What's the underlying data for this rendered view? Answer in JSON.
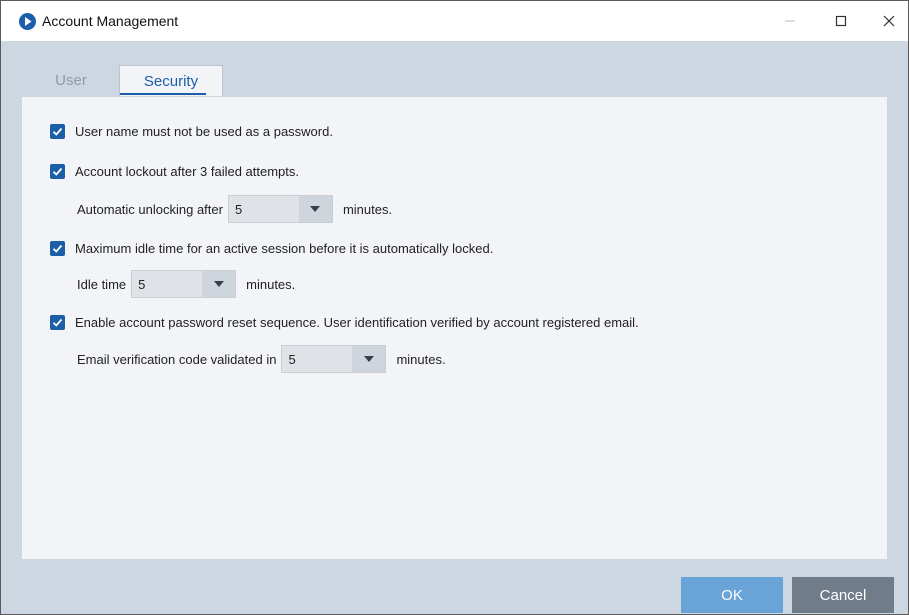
{
  "window": {
    "title": "Account Management",
    "controls": {
      "minimize": "minimize-icon",
      "maximize": "maximize-icon",
      "close": "close-icon"
    }
  },
  "tabs": [
    {
      "label": "User",
      "active": false
    },
    {
      "label": "Security",
      "active": true
    }
  ],
  "security": {
    "options": [
      {
        "label": "User name must not be used as a password.",
        "checked": true
      },
      {
        "label": "Account lockout after 3 failed attempts.",
        "checked": true,
        "sub": {
          "prefix": "Automatic unlocking after",
          "value": "5",
          "suffix": "minutes."
        }
      },
      {
        "label": "Maximum idle time for an active session before it is automatically locked.",
        "checked": true,
        "sub": {
          "prefix": "Idle time",
          "value": "5",
          "suffix": "minutes."
        }
      },
      {
        "label": "Enable account password reset sequence. User identification verified by account registered email.",
        "checked": true,
        "sub": {
          "prefix": "Email verification code validated in",
          "value": "5",
          "suffix": "minutes."
        }
      }
    ]
  },
  "footer": {
    "ok_label": "OK",
    "cancel_label": "Cancel"
  },
  "colors": {
    "accent": "#1c5fa8",
    "background": "#cdd7e1",
    "panel": "#f2f4f7",
    "ok": "#6aa3d8",
    "cancel": "#707c89"
  }
}
